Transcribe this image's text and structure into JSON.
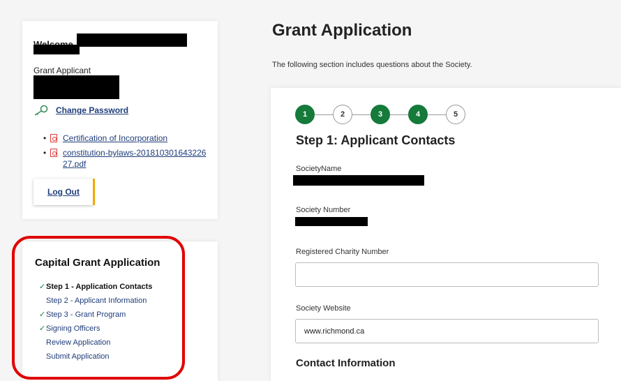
{
  "user_card": {
    "welcome": "Welcome,",
    "role": "Grant Applicant",
    "change_password": "Change Password",
    "documents": [
      "Certification of Incorporation",
      "constitution-bylaws-20181030164322627.pdf"
    ],
    "logout": "Log Out"
  },
  "nav": {
    "title": "Capital Grant Application",
    "items": [
      {
        "label": "Step 1 - Application Contacts",
        "check": "✓"
      },
      {
        "label": "Step 2 - Applicant Information",
        "check": ""
      },
      {
        "label": "Step 3 - Grant Program",
        "check": "✓"
      },
      {
        "label": "Signing Officers",
        "check": "✓"
      },
      {
        "label": "Review Application",
        "check": ""
      },
      {
        "label": "Submit Application",
        "check": ""
      }
    ]
  },
  "main": {
    "title": "Grant Application",
    "description": "The following section includes questions about the Society.",
    "steps": [
      "1",
      "2",
      "3",
      "4",
      "5"
    ],
    "step_heading": "Step 1: Applicant Contacts",
    "fields": {
      "society_name_label": "SocietyName",
      "society_number_label": "Society Number",
      "charity_number_label": "Registered Charity Number",
      "charity_number_value": "",
      "website_label": "Society Website",
      "website_value": "www.richmond.ca"
    },
    "contact_heading": "Contact Information"
  },
  "colors": {
    "step_complete": "#157a3a",
    "link": "#1f3d7a",
    "highlight": "#e00000",
    "logout_accent": "#f2a900"
  }
}
